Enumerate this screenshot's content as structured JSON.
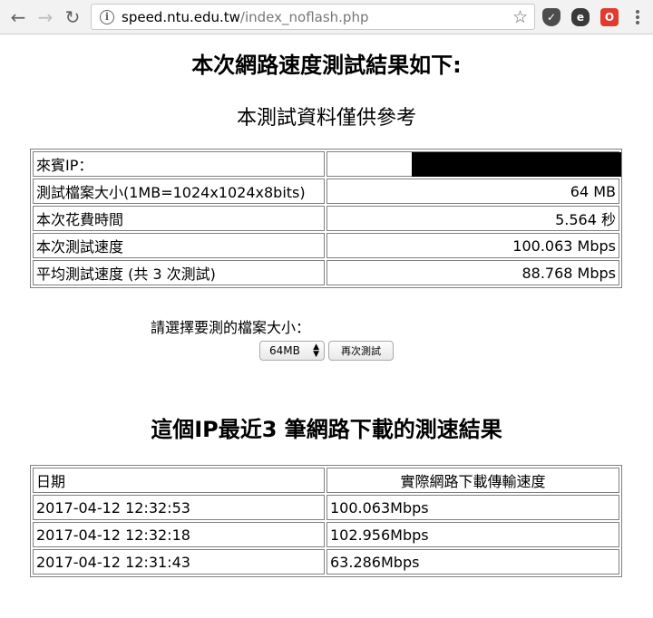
{
  "browser": {
    "url_host": "speed.ntu.edu.tw",
    "url_path": "/index_noflash.php"
  },
  "page": {
    "title": "本次網路速度測試結果如下:",
    "subtitle": "本測試資料僅供參考"
  },
  "results": [
    {
      "label": "來賓IP：",
      "value": ""
    },
    {
      "label": "測試檔案大小(1MB=1024x1024x8bits)",
      "value": "64 MB"
    },
    {
      "label": "本次花費時間",
      "value": "5.564 秒"
    },
    {
      "label": "本次測試速度",
      "value": "100.063 Mbps"
    },
    {
      "label": "平均測試速度 (共 3 次測試)",
      "value": "88.768 Mbps"
    }
  ],
  "retest": {
    "prompt": "請選擇要測的檔案大小：",
    "selected_size": "64MB",
    "button_label": "再次測試"
  },
  "history": {
    "title": "這個IP最近3 筆網路下載的測速結果",
    "headers": [
      "日期",
      "實際網路下載傳輸速度"
    ],
    "rows": [
      [
        "2017-04-12 12:32:53",
        "100.063Mbps"
      ],
      [
        "2017-04-12 12:32:18",
        "102.956Mbps"
      ],
      [
        "2017-04-12 12:31:43",
        "63.286Mbps"
      ]
    ]
  },
  "icons": [
    "back-icon",
    "forward-icon",
    "reload-icon",
    "info-icon",
    "star-icon",
    "pocket-icon",
    "evernote-icon",
    "opera-icon",
    "menu-icon"
  ]
}
